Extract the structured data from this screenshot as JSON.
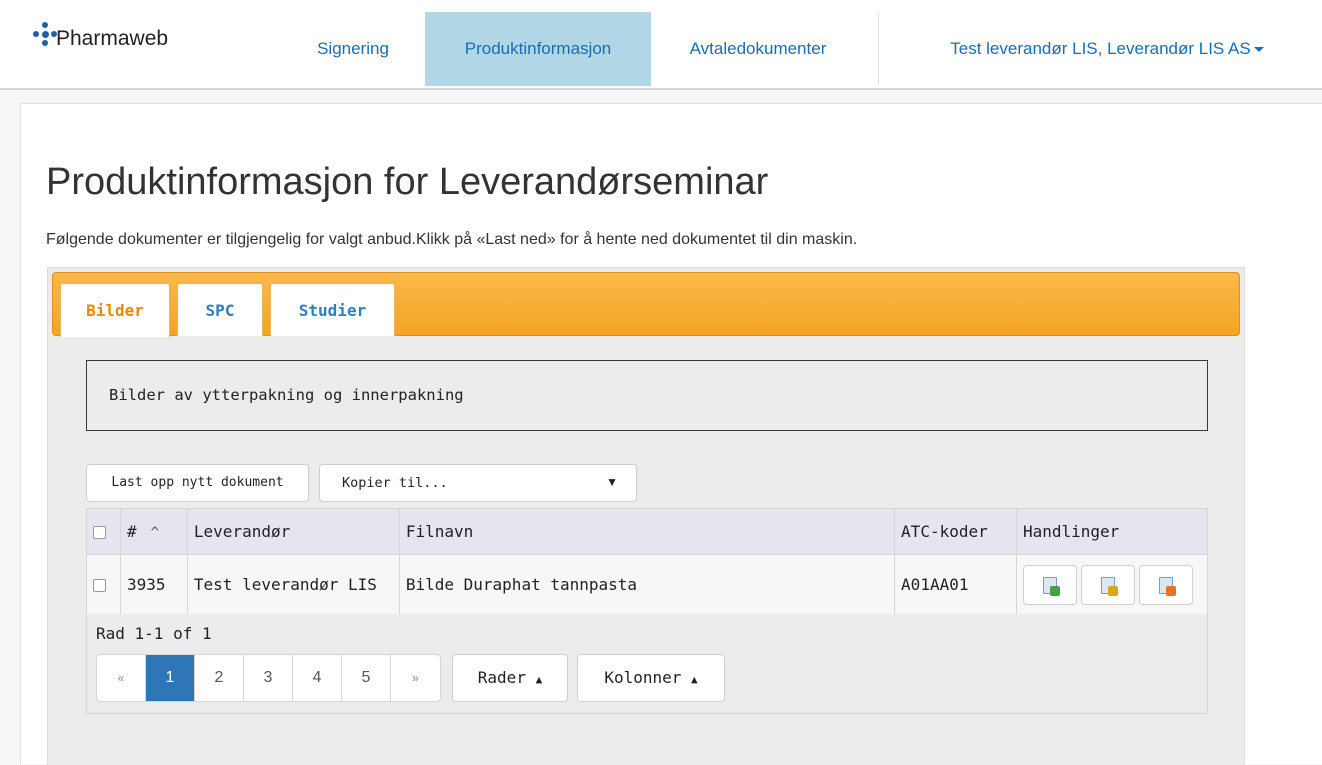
{
  "brand": {
    "name": "Pharmaweb"
  },
  "nav": {
    "items": [
      {
        "label": "Signering"
      },
      {
        "label": "Produktinformasjon"
      },
      {
        "label": "Avtaledokumenter"
      }
    ],
    "user_menu": "Test leverandør LIS, Leverandør LIS AS"
  },
  "page": {
    "title": "Produktinformasjon for Leverandørseminar",
    "intro": "Følgende dokumenter er tilgjengelig for valgt anbud.Klikk på «Last ned» for å hente ned dokumentet til din maskin."
  },
  "tabs": [
    {
      "label": "Bilder"
    },
    {
      "label": "SPC"
    },
    {
      "label": "Studier"
    }
  ],
  "description": "Bilder av ytterpakning og innerpakning",
  "toolbar": {
    "upload_label": "Last opp nytt dokument",
    "copy_select_value": "Kopier til..."
  },
  "table": {
    "headers": [
      "#",
      "Leverandør",
      "Filnavn",
      "ATC-koder",
      "Handlinger"
    ],
    "rows": [
      {
        "id": "3935",
        "leverandor": "Test leverandør LIS",
        "filnavn": "Bilde Duraphat tannpasta",
        "atc": "A01AA01"
      }
    ]
  },
  "footer": {
    "row_info": "Rad 1-1 of 1",
    "pages": [
      "«",
      "1",
      "2",
      "3",
      "4",
      "5",
      "»"
    ],
    "rows_button": "Rader",
    "columns_button": "Kolonner"
  },
  "colors": {
    "nav_active_bg": "#b1d7e6",
    "link": "#1a6db0",
    "tab_strip": "#f5a422",
    "active_page": "#2e76b5"
  }
}
